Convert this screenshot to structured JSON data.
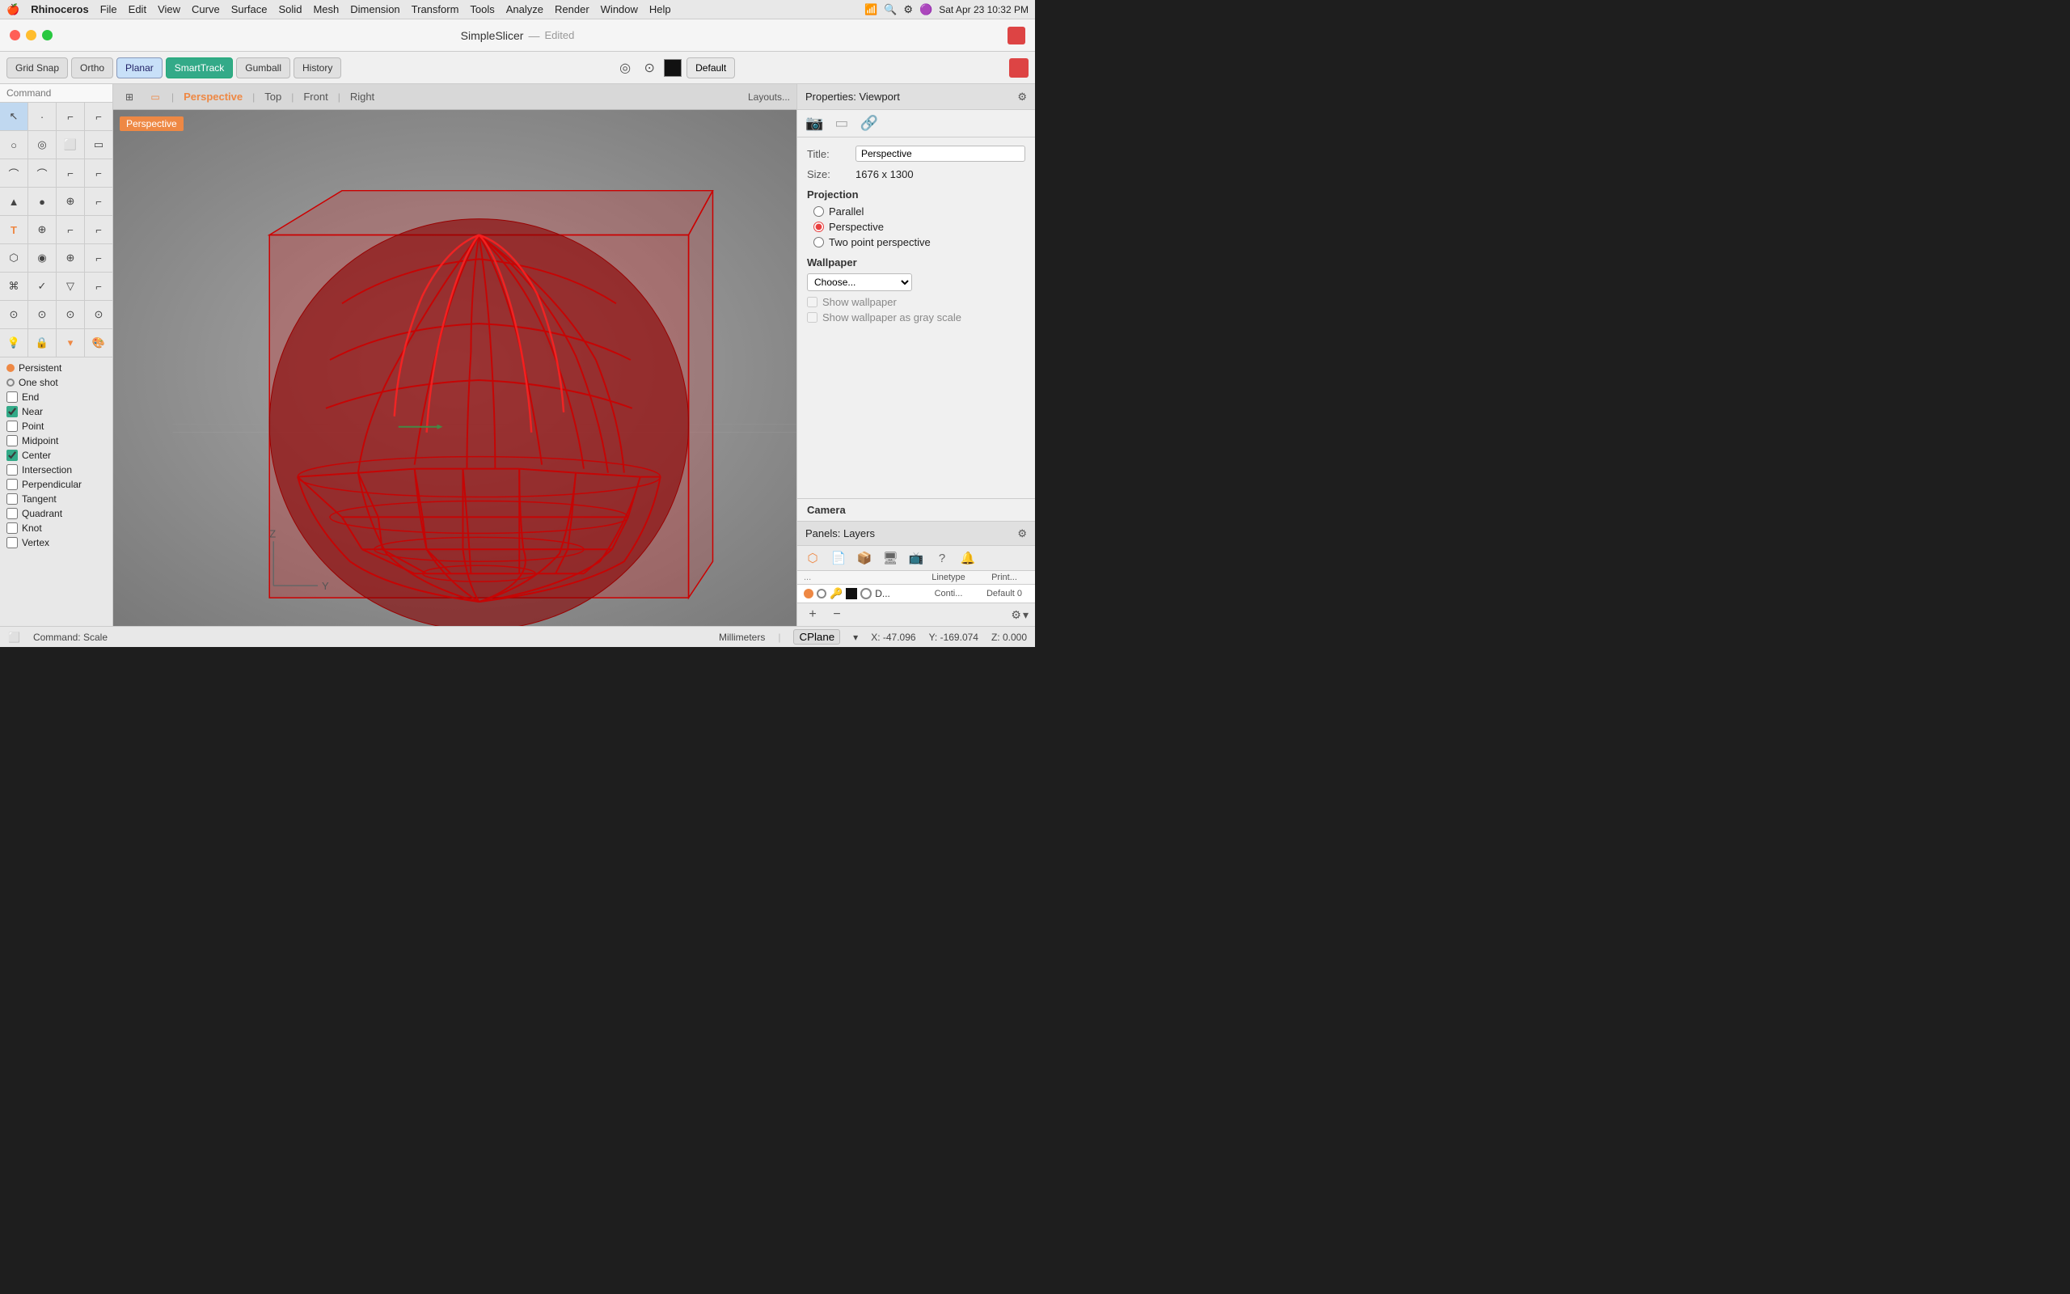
{
  "app": {
    "name": "Rhinoceros",
    "title": "SimpleSlicer",
    "title_suffix": "Edited"
  },
  "menubar": {
    "apple": "🍎",
    "app_name": "Rhinoceros",
    "menus": [
      "File",
      "Edit",
      "View",
      "Curve",
      "Surface",
      "Solid",
      "Mesh",
      "Dimension",
      "Transform",
      "Tools",
      "Analyze",
      "Render",
      "Window",
      "Help"
    ],
    "datetime": "Sat Apr 23  10:32 PM"
  },
  "toolbar": {
    "grid_snap": "Grid Snap",
    "ortho": "Ortho",
    "planar": "Planar",
    "smart_track": "SmartTrack",
    "gumball": "Gumball",
    "history": "History",
    "default": "Default"
  },
  "viewport_tabs": {
    "icon_label": "⊞",
    "tabs": [
      "Perspective",
      "Top",
      "Front",
      "Right"
    ],
    "active_tab": "Perspective",
    "layouts_btn": "Layouts..."
  },
  "viewport": {
    "active_label": "Perspective"
  },
  "left_panel": {
    "command_placeholder": "Command",
    "tools": [
      "↖",
      "⊙",
      "⌐",
      "⌐",
      "○",
      "◎",
      "⌐",
      "▭",
      "⌒",
      "⌒",
      "⌐",
      "⌐",
      "▲",
      "●",
      "⊕",
      "⌐",
      "✏",
      "⊕",
      "⌐",
      "⌐",
      "⬡",
      "◉",
      "⊕",
      "⌐",
      "⌘",
      "✓",
      "▽",
      "⌐",
      "⊙",
      "⊙",
      "⊙",
      "⊙",
      "💡",
      "🔒",
      "▾",
      "●"
    ]
  },
  "snap_items": [
    {
      "label": "Persistent",
      "type": "radio",
      "checked": true
    },
    {
      "label": "One shot",
      "type": "radio",
      "checked": false
    },
    {
      "label": "End",
      "type": "checkbox",
      "checked": false
    },
    {
      "label": "Near",
      "type": "checkbox",
      "checked": true
    },
    {
      "label": "Point",
      "type": "checkbox",
      "checked": false
    },
    {
      "label": "Midpoint",
      "type": "checkbox",
      "checked": false
    },
    {
      "label": "Center",
      "type": "checkbox",
      "checked": true
    },
    {
      "label": "Intersection",
      "type": "checkbox",
      "checked": false
    },
    {
      "label": "Perpendicular",
      "type": "checkbox",
      "checked": false
    },
    {
      "label": "Tangent",
      "type": "checkbox",
      "checked": false
    },
    {
      "label": "Quadrant",
      "type": "checkbox",
      "checked": false
    },
    {
      "label": "Knot",
      "type": "checkbox",
      "checked": false
    },
    {
      "label": "Vertex",
      "type": "checkbox",
      "checked": false
    }
  ],
  "properties": {
    "header": "Properties: Viewport",
    "icons": [
      "📷",
      "▭",
      "🔗"
    ],
    "title_label": "Title:",
    "title_value": "Perspective",
    "size_label": "Size:",
    "size_value": "1676 x 1300",
    "projection_label": "Projection",
    "projection_options": [
      {
        "label": "Parallel",
        "checked": false
      },
      {
        "label": "Perspective",
        "checked": true
      },
      {
        "label": "Two point perspective",
        "checked": false
      }
    ],
    "wallpaper_label": "Wallpaper",
    "wallpaper_choose": "Choose...",
    "show_wallpaper": "Show wallpaper",
    "show_grayscale": "Show wallpaper as gray scale",
    "camera_label": "Camera"
  },
  "layers": {
    "header": "Panels: Layers",
    "col_dots": "...",
    "col_name": "",
    "col_linetype": "Linetype",
    "col_print": "Print...",
    "row_name": "D...",
    "row_linetype": "Conti...",
    "row_print": "Default 0"
  },
  "statusbar": {
    "command": "Command: Scale",
    "units": "Millimeters",
    "cplane": "CPlane",
    "x": "X: -47.096",
    "y": "Y: -169.074",
    "z": "Z: 0.000"
  },
  "colors": {
    "accent": "#e84040",
    "smarttrack": "#33aa88",
    "active_tab": "#e84040"
  }
}
